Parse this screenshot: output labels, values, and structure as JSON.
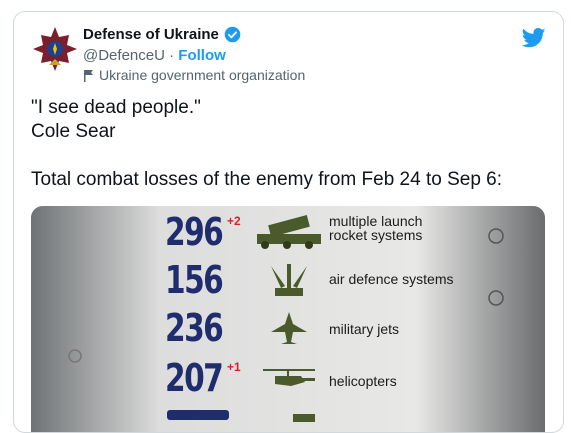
{
  "tweet": {
    "display_name": "Defense of Ukraine",
    "handle": "@DefenceU",
    "separator": "·",
    "follow_label": "Follow",
    "org_label": "Ukraine government organization",
    "text_lines": [
      "\"I see dead people.\"",
      "Cole Sear",
      "",
      "Total combat losses of the enemy from Feb 24 to Sep 6:"
    ]
  },
  "infographic": {
    "rows": [
      {
        "number": "296",
        "delta": "+2",
        "label_lines": [
          "multiple launch",
          "rocket systems"
        ],
        "icon": "rocket-launcher-icon"
      },
      {
        "number": "156",
        "delta": "",
        "label_lines": [
          "air defence systems"
        ],
        "icon": "air-defence-icon"
      },
      {
        "number": "236",
        "delta": "",
        "label_lines": [
          "military jets"
        ],
        "icon": "jet-icon"
      },
      {
        "number": "207",
        "delta": "+1",
        "label_lines": [
          "helicopters"
        ],
        "icon": "helicopter-icon"
      }
    ],
    "colors": {
      "number": "#1f2d6e",
      "delta": "#d6222b",
      "icon": "#4a5a2a"
    }
  },
  "colors": {
    "accent": "#1d9bf0",
    "text": "#0f1419",
    "muted": "#536471"
  }
}
